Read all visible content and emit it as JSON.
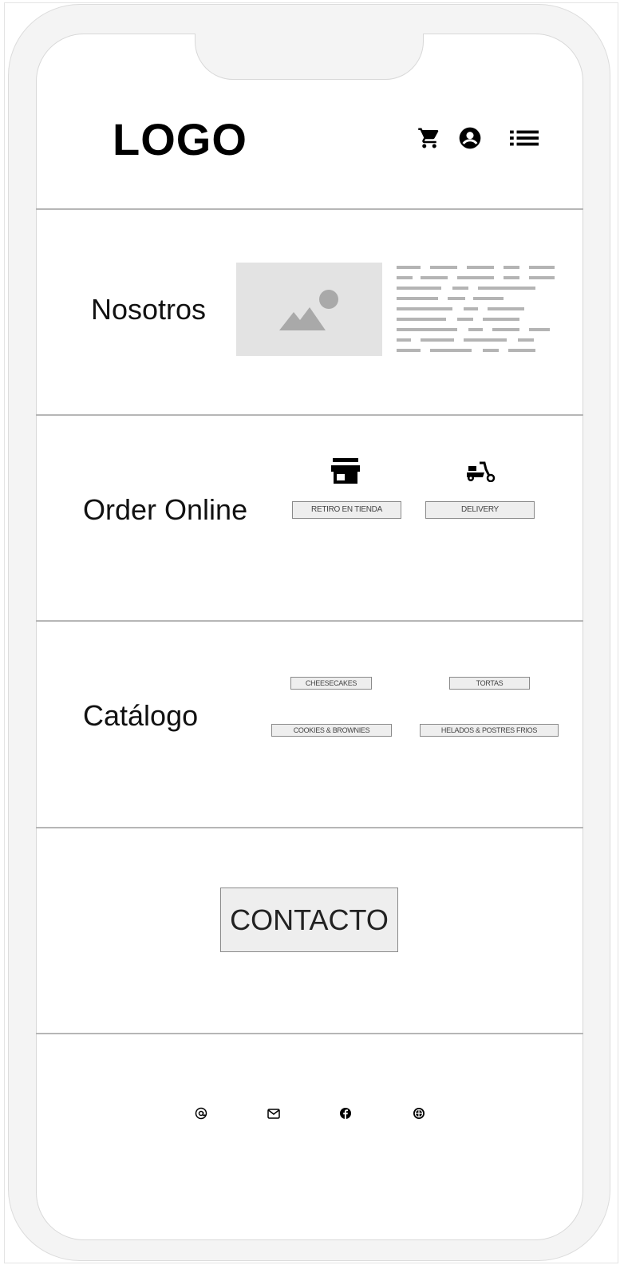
{
  "header": {
    "logo": "LOGO",
    "icons": [
      "cart-icon",
      "account-icon",
      "menu-list-icon"
    ]
  },
  "sections": {
    "nosotros": {
      "title": "Nosotros",
      "image": "image-placeholder-icon"
    },
    "order": {
      "title": "Order Online",
      "options": [
        {
          "label": "RETIRO EN TIENDA",
          "icon": "store-icon"
        },
        {
          "label": "DELIVERY",
          "icon": "scooter-icon"
        }
      ]
    },
    "catalogo": {
      "title": "Catálogo",
      "items": [
        "CHEESECAKES",
        "TORTAS",
        "COOKIES & BROWNIES",
        "HELADOS & POSTRES FRIOS"
      ]
    },
    "contacto": {
      "label": "CONTACTO"
    }
  },
  "footer": {
    "icons": [
      "at-icon",
      "mail-icon",
      "facebook-icon",
      "web-icon"
    ]
  },
  "colors": {
    "frame": "#f4f4f4",
    "divider": "#b6b6b6",
    "placeholder": "#e3e3e3",
    "button": "#eeeeee"
  }
}
